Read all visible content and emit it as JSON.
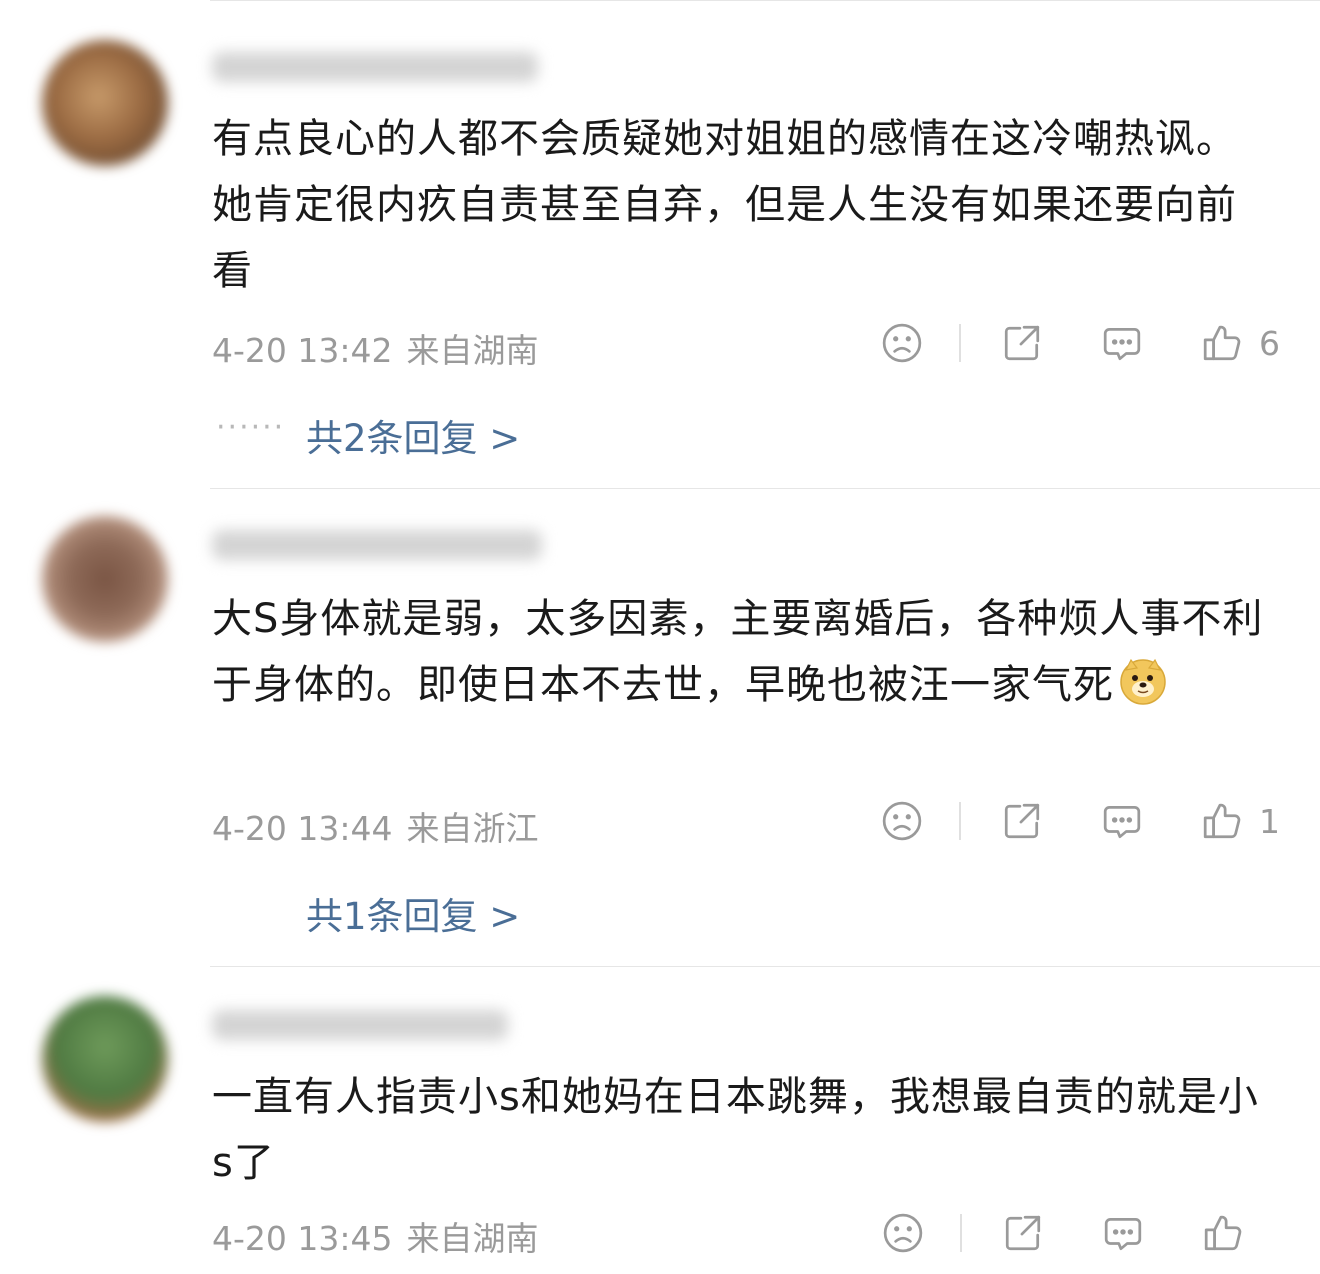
{
  "comments": [
    {
      "text": "有点良心的人都不会质疑她对姐姐的感情在这冷嘲热讽。她肯定很内疚自责甚至自弃，但是人生没有如果还要向前看",
      "time": "4-20 13:42",
      "location": "来自湖南",
      "likes": "6",
      "replies_label": "共2条回复 >",
      "dots": "······"
    },
    {
      "text": "大S身体就是弱，太多因素，主要离婚后，各种烦人事不利于身体的。即使日本不去世，早晚也被汪一家气死",
      "time": "4-20 13:44",
      "location": "来自浙江",
      "likes": "1",
      "replies_label": "共1条回复 >"
    },
    {
      "text": "一直有人指责小s和她妈在日本跳舞，我想最自责的就是小s了",
      "time": "4-20 13:45",
      "location": "来自湖南",
      "likes": ""
    }
  ],
  "icons": {
    "emotion": "sad-face-icon",
    "share": "share-icon",
    "reply": "comment-icon",
    "like": "thumbs-up-icon"
  },
  "colors": {
    "link": "#4a6e96",
    "meta": "#9a9a9a",
    "text": "#1a1a1a"
  }
}
